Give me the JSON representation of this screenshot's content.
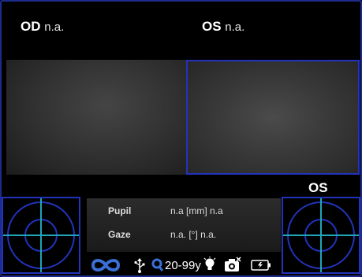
{
  "header": {
    "od": {
      "eye": "OD",
      "value": "n.a."
    },
    "os": {
      "eye": "OS",
      "value": "n.a."
    }
  },
  "side_label": "OS",
  "measurements": {
    "pupil": {
      "label": "Pupil",
      "value": "n.a [mm] n.a"
    },
    "gaze": {
      "label": "Gaze",
      "value": "n.a. [°] n.a."
    }
  },
  "status": {
    "icons": [
      "infinity-icon",
      "usb-icon",
      "search-icon",
      "lightbulb-icon",
      "camera-icon",
      "battery-icon"
    ],
    "age_range": "20-99y"
  },
  "colors": {
    "accent_blue": "#2233bb",
    "crosshair": "#1fa6b8",
    "icon_blue": "#3a6fd6"
  }
}
